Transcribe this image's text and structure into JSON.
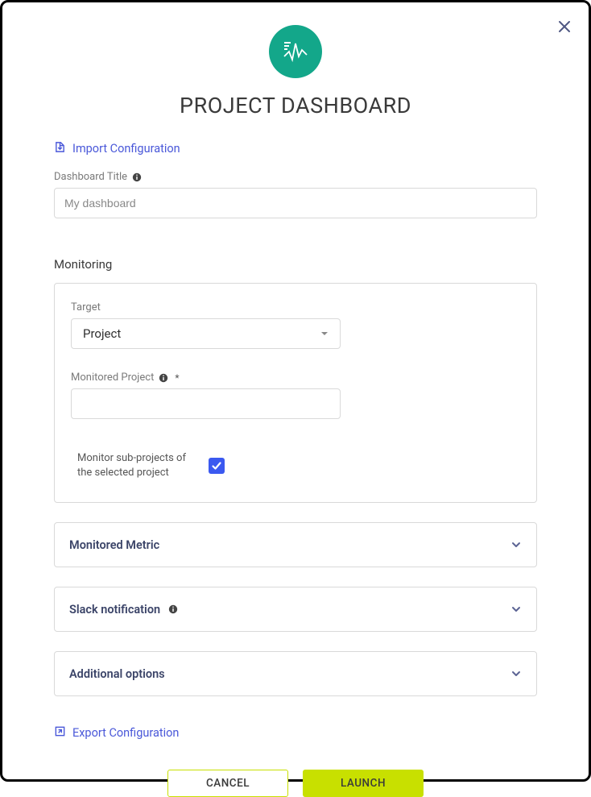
{
  "header": {
    "title": "PROJECT DASHBOARD"
  },
  "links": {
    "import": "Import Configuration",
    "export": "Export Configuration"
  },
  "fields": {
    "dashboard_title_label": "Dashboard Title",
    "dashboard_title_placeholder": "My dashboard",
    "monitoring_label": "Monitoring",
    "target_label": "Target",
    "target_value": "Project",
    "monitored_project_label": "Monitored Project",
    "monitor_subprojects_label": "Monitor sub-projects of the selected project",
    "monitor_subprojects_checked": true
  },
  "accordions": {
    "metric": "Monitored Metric",
    "slack": "Slack notification",
    "additional": "Additional options"
  },
  "footer": {
    "cancel": "CANCEL",
    "launch": "LAUNCH"
  },
  "colors": {
    "brand_green": "#13a78a",
    "link_blue": "#4a58d9",
    "checkbox_blue": "#3b59f0",
    "action_lime": "#c8e000"
  }
}
